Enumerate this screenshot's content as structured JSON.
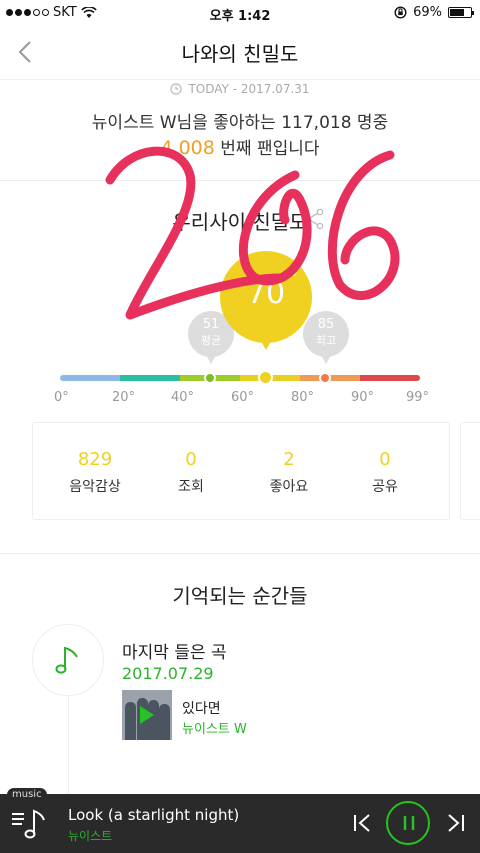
{
  "status_bar": {
    "carrier": "SKT",
    "time": "오후 1:42",
    "battery": "69%",
    "battery_level": 0.69
  },
  "header": {
    "title": "나와의 친밀도"
  },
  "fan_info": {
    "today": "TODAY - 2017.07.31",
    "line1": "뉴이스트 W님을 좋아하는 117,018 명중",
    "rank": "4,008",
    "rank_suffix": " 번째 팬입니다"
  },
  "intimacy": {
    "title": "우리사이 친밀도",
    "value": "70",
    "unit": "°",
    "average": {
      "value": "51",
      "label": "평균"
    },
    "best": {
      "value": "85",
      "label": "최고"
    },
    "scale_ticks": [
      "0°",
      "20°",
      "40°",
      "60°",
      "80°",
      "90°",
      "99°"
    ],
    "scale_colors": [
      "#8cb8e6",
      "#28bfa0",
      "#9ccd28",
      "#e8d020",
      "#f09a5a",
      "#e04848"
    ]
  },
  "stats": [
    {
      "value": "829",
      "label": "음악감상"
    },
    {
      "value": "0",
      "label": "조회"
    },
    {
      "value": "2",
      "label": "좋아요"
    },
    {
      "value": "0",
      "label": "공유"
    }
  ],
  "memories": {
    "title": "기억되는 순간들",
    "item": {
      "heading": "마지막 들은 곡",
      "date": "2017.07.29",
      "song": "있다면",
      "artist": "뉴이스트 W"
    }
  },
  "player": {
    "tag": "music",
    "title": "Look (a starlight night)",
    "artist": "뉴이스트"
  },
  "overlay": {
    "handwritten": "206",
    "color": "#e8305c"
  }
}
